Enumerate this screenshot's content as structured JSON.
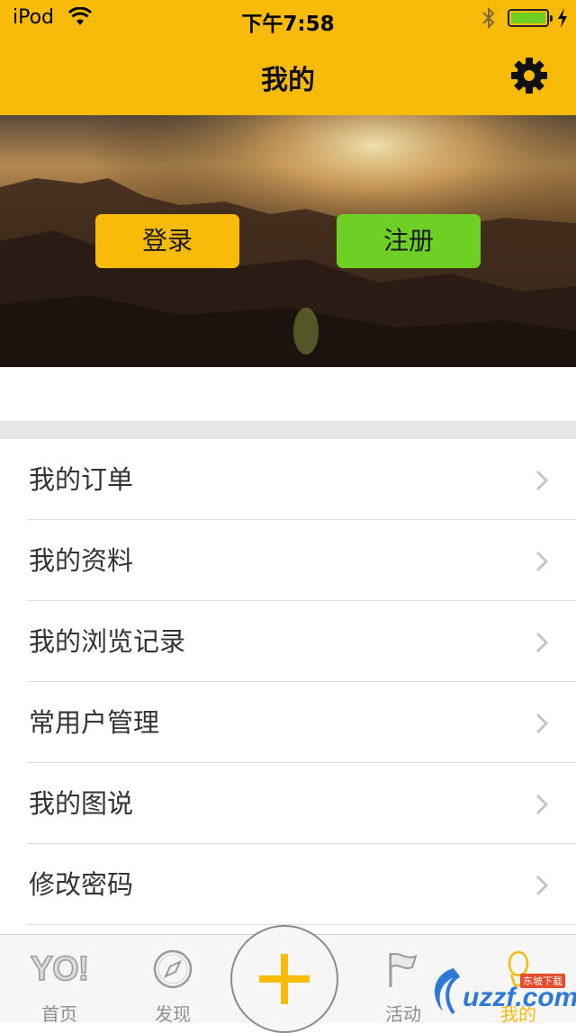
{
  "status_bar": {
    "carrier": "iPod",
    "time": "下午7:58"
  },
  "nav": {
    "title": "我的",
    "settings_icon": "gear-icon"
  },
  "hero": {
    "login_label": "登录",
    "register_label": "注册",
    "colors": {
      "login": "#f8bb0a",
      "register": "#6ed024"
    }
  },
  "menu": {
    "items": [
      {
        "label": "我的订单"
      },
      {
        "label": "我的资料"
      },
      {
        "label": "我的浏览记录"
      },
      {
        "label": "常用户管理"
      },
      {
        "label": "我的图说"
      },
      {
        "label": "修改密码"
      }
    ]
  },
  "tabbar": {
    "tabs": [
      {
        "label": "首页",
        "icon": "yo-logo-icon",
        "icon_text": "YO!"
      },
      {
        "label": "发现",
        "icon": "compass-icon"
      },
      {
        "label": "",
        "icon": "plus-icon"
      },
      {
        "label": "活动",
        "icon": "flag-icon"
      },
      {
        "label": "我的",
        "icon": "profile-icon"
      }
    ],
    "accent": "#f8bb0a"
  },
  "watermark": {
    "text": "uzzf.com",
    "sub": "东坡下载"
  }
}
